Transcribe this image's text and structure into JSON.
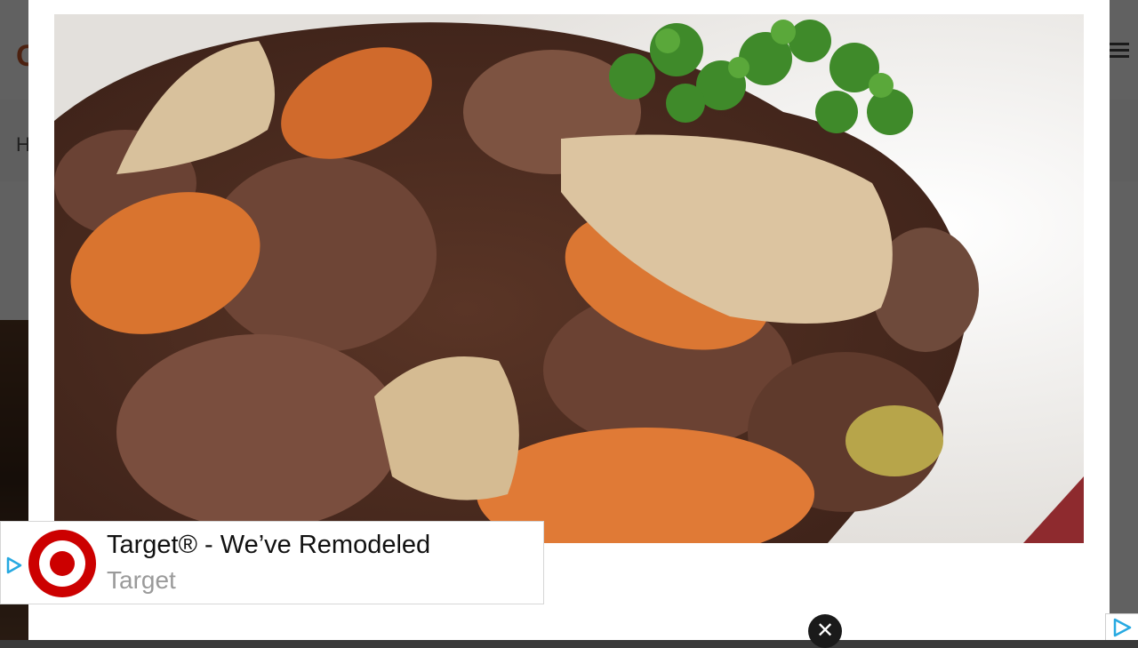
{
  "background_page": {
    "logo_letter": "C",
    "nav_letter": "H"
  },
  "ad": {
    "title": "Target® - We’ve Remodeled",
    "advertiser": "Target",
    "brand_color": "#cc0000"
  },
  "close_button": {
    "label": "✕"
  },
  "colors": {
    "overlay": "#000000",
    "modal": "#ffffff"
  }
}
